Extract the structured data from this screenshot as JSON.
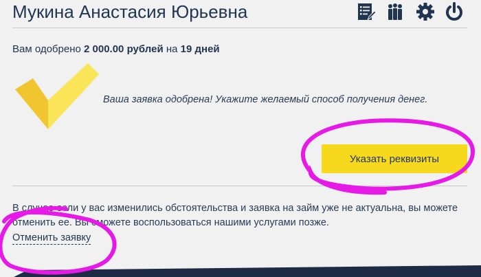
{
  "header": {
    "user_name": "Мукина Анастасия Юрьевна",
    "icons": [
      "list-edit-icon",
      "people-icon",
      "gear-icon",
      "power-icon"
    ]
  },
  "approval": {
    "prefix": "Вам одобрено",
    "amount": "2 000.00 рублей",
    "middle": "на",
    "term": "19 дней"
  },
  "status": {
    "message": "Ваша заявка одобрена! Укажите желаемый способ получения денег."
  },
  "actions": {
    "details_button": "Указать реквизиты",
    "cancel_link": "Отменить заявку"
  },
  "info_text": "В случае если у вас изменились обстоятельства и заявка на займ уже не актуальна, вы можете отменить ее. Вы сможете воспользоваться нашими услугами позже.",
  "colors": {
    "accent_yellow": "#f6d91c",
    "text_navy": "#1f3550",
    "annotation_magenta": "#e619e6",
    "footer_navy": "#1e2b45"
  }
}
